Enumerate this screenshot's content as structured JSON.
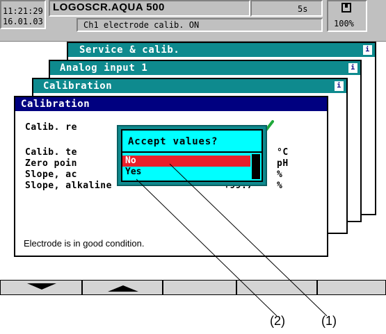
{
  "header": {
    "time": "11:21:29",
    "date": "16.01.03",
    "device_title": "LOGOSCR.AQUA 500",
    "interval": "5s",
    "status": "Ch1 electrode calib. ON",
    "zoom": "100%"
  },
  "windows": {
    "service": "Service & calib.",
    "analog": "Analog input 1",
    "calibration_back": "Calibration",
    "calibration_front": "Calibration"
  },
  "calib": {
    "row1_label": "Calib. re",
    "row2_label": "Calib. te",
    "row2_unit": "°C",
    "row3_label": "Zero poin",
    "row3_unit": "pH",
    "row4_label": "Slope, ac",
    "row4_unit": "%",
    "row5_label": "Slope, alkaline",
    "row5_value": "+99.7",
    "row5_unit": "%",
    "status_message": "Electrode is in good condition."
  },
  "dialog": {
    "title": "Accept values?",
    "option_no": "No",
    "option_yes": "Yes"
  },
  "callouts": {
    "c1": "(1)",
    "c2": "(2)"
  },
  "colors": {
    "teal": "#0e8a8e",
    "navy": "#000080",
    "selection": "#e8202a",
    "check": "#1fa83a",
    "dialog_bg": "#00ffff"
  }
}
